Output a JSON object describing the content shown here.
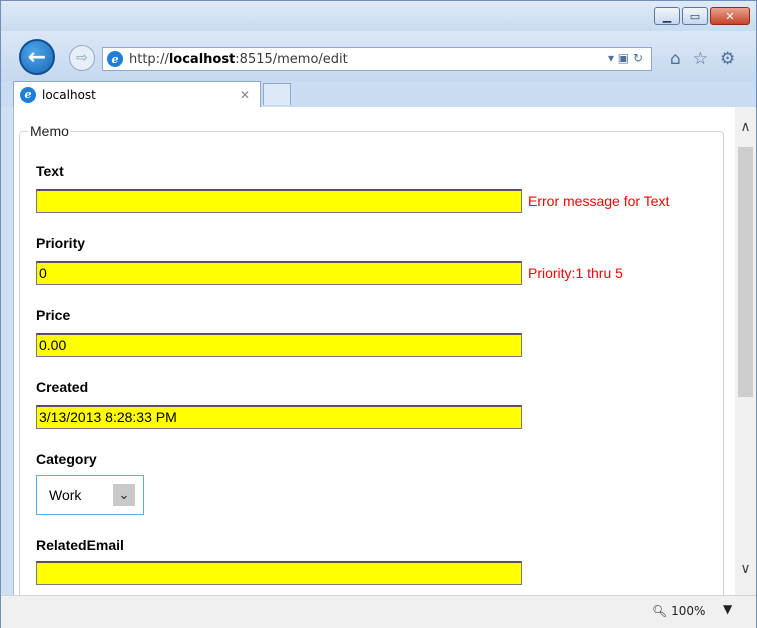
{
  "browser": {
    "url_prefix": "http://",
    "url_host": "localhost",
    "url_rest": ":8515/memo/edit",
    "tab_title": "localhost",
    "zoom": "100%"
  },
  "form": {
    "legend": "Memo",
    "fields": {
      "text": {
        "label": "Text",
        "value": "",
        "error": "Error message for Text"
      },
      "priority": {
        "label": "Priority",
        "value": "0",
        "error": "Priority:1 thru 5"
      },
      "price": {
        "label": "Price",
        "value": "0.00"
      },
      "created": {
        "label": "Created",
        "value": "3/13/2013 8:28:33 PM"
      },
      "category": {
        "label": "Category",
        "value": "Work"
      },
      "related_email": {
        "label": "RelatedEmail",
        "value": ""
      }
    }
  },
  "colors": {
    "field_bg": "#ffff00",
    "error_text": "#ff0000"
  },
  "icons": [
    "back-icon",
    "forward-icon",
    "ie-logo-icon",
    "home-icon",
    "favorites-icon",
    "settings-icon",
    "zoom-icon",
    "minimize-icon",
    "maximize-icon",
    "close-icon",
    "chevron-down-icon"
  ]
}
